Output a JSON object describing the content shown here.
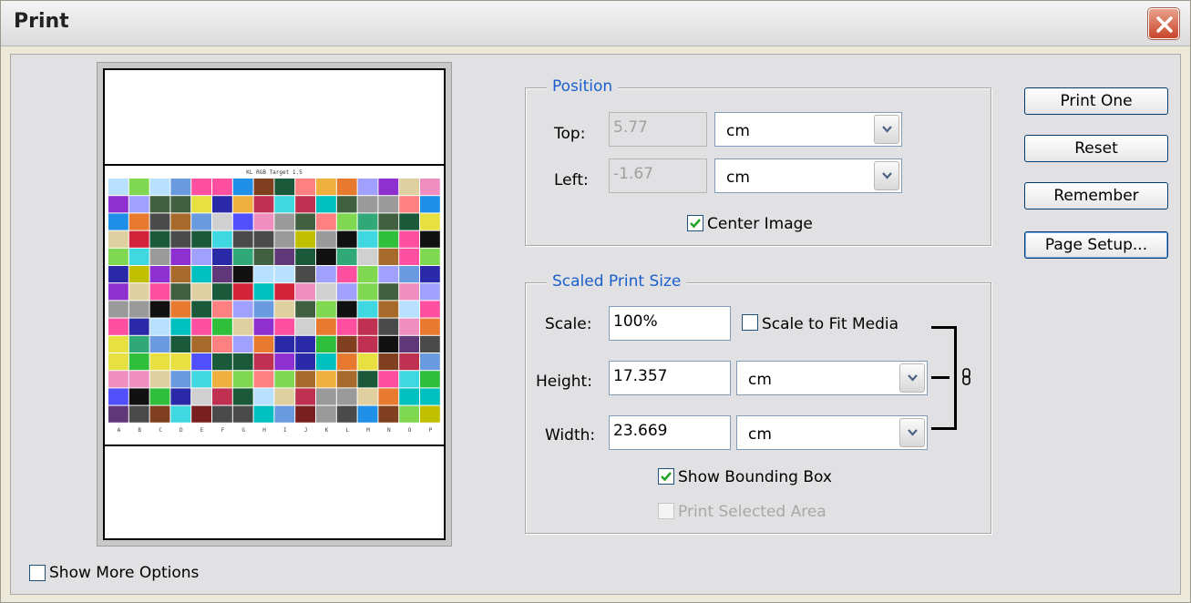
{
  "window": {
    "title": "Print"
  },
  "preview": {
    "target_label": "KL RGB Target 1.5",
    "columns": [
      "A",
      "B",
      "C",
      "D",
      "E",
      "F",
      "G",
      "H",
      "I",
      "J",
      "K",
      "L",
      "M",
      "N",
      "O",
      "P"
    ]
  },
  "position": {
    "legend": "Position",
    "top_label": "Top:",
    "top_value": "5.77",
    "top_unit": "cm",
    "left_label": "Left:",
    "left_value": "-1.67",
    "left_unit": "cm",
    "center_image_label": "Center Image",
    "center_image_checked": true
  },
  "scaled": {
    "legend": "Scaled Print Size",
    "scale_label": "Scale:",
    "scale_value": "100%",
    "scale_to_fit_label": "Scale to Fit Media",
    "scale_to_fit_checked": false,
    "height_label": "Height:",
    "height_value": "17.357",
    "height_unit": "cm",
    "width_label": "Width:",
    "width_value": "23.669",
    "width_unit": "cm",
    "show_bbox_label": "Show Bounding Box",
    "show_bbox_checked": true,
    "print_selected_label": "Print Selected Area",
    "print_selected_enabled": false
  },
  "buttons": {
    "print_one": "Print One",
    "reset": "Reset",
    "remember": "Remember",
    "page_setup": "Page Setup..."
  },
  "show_more_options": {
    "label": "Show More Options",
    "checked": false
  }
}
